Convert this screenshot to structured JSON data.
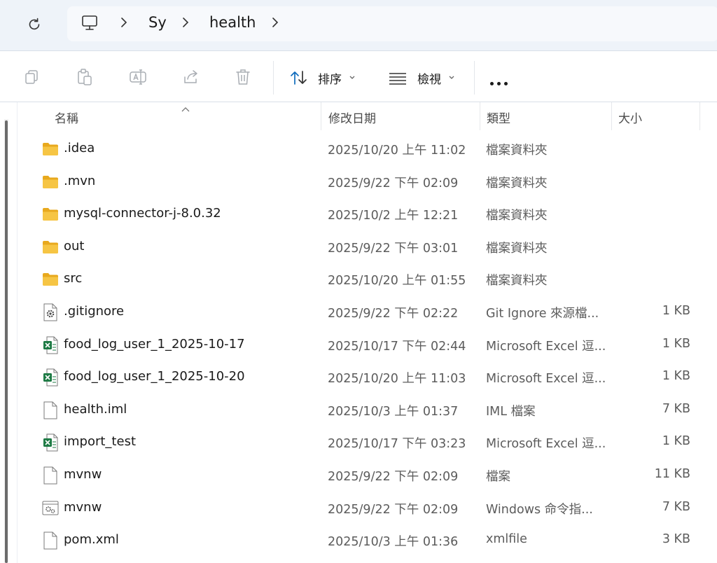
{
  "breadcrumb": {
    "root_icon": "computer-icon",
    "items": [
      "Sy",
      "health"
    ]
  },
  "toolbar": {
    "copy_icon": "copy-icon",
    "paste_icon": "paste-icon",
    "rename_icon": "rename-icon",
    "share_icon": "share-icon",
    "delete_icon": "trash-icon",
    "sort_label": "排序",
    "view_label": "檢視",
    "more_icon": "more-icon"
  },
  "columns": {
    "name": "名稱",
    "date": "修改日期",
    "type": "類型",
    "size": "大小"
  },
  "colors": {
    "address_bar_bg": "#eef3f9",
    "folder": "#f6c544",
    "excel": "#1d7a44"
  },
  "files": [
    {
      "icon": "folder-icon",
      "name": ".idea",
      "date": "2025/10/20 上午 11:02",
      "type": "檔案資料夾",
      "size": ""
    },
    {
      "icon": "folder-icon",
      "name": ".mvn",
      "date": "2025/9/22 下午 02:09",
      "type": "檔案資料夾",
      "size": ""
    },
    {
      "icon": "folder-icon",
      "name": "mysql-connector-j-8.0.32",
      "date": "2025/10/2 上午 12:21",
      "type": "檔案資料夾",
      "size": ""
    },
    {
      "icon": "folder-icon",
      "name": "out",
      "date": "2025/9/22 下午 03:01",
      "type": "檔案資料夾",
      "size": ""
    },
    {
      "icon": "folder-icon",
      "name": "src",
      "date": "2025/10/20 上午 01:55",
      "type": "檔案資料夾",
      "size": ""
    },
    {
      "icon": "settings-file-icon",
      "name": ".gitignore",
      "date": "2025/9/22 下午 02:22",
      "type": "Git Ignore 來源檔...",
      "size": "1 KB"
    },
    {
      "icon": "excel-icon",
      "name": "food_log_user_1_2025-10-17",
      "date": "2025/10/17 下午 02:44",
      "type": "Microsoft Excel 逗...",
      "size": "1 KB"
    },
    {
      "icon": "excel-icon",
      "name": "food_log_user_1_2025-10-20",
      "date": "2025/10/20 上午 11:03",
      "type": "Microsoft Excel 逗...",
      "size": "1 KB"
    },
    {
      "icon": "file-icon",
      "name": "health.iml",
      "date": "2025/10/3 上午 01:37",
      "type": "IML 檔案",
      "size": "7 KB"
    },
    {
      "icon": "excel-icon",
      "name": "import_test",
      "date": "2025/10/17 下午 03:23",
      "type": "Microsoft Excel 逗...",
      "size": "1 KB"
    },
    {
      "icon": "file-icon",
      "name": "mvnw",
      "date": "2025/9/22 下午 02:09",
      "type": "檔案",
      "size": "11 KB"
    },
    {
      "icon": "cmd-file-icon",
      "name": "mvnw",
      "date": "2025/9/22 下午 02:09",
      "type": "Windows 命令指...",
      "size": "7 KB"
    },
    {
      "icon": "file-icon",
      "name": "pom.xml",
      "date": "2025/10/3 上午 01:36",
      "type": "xmlfile",
      "size": "3 KB"
    }
  ]
}
